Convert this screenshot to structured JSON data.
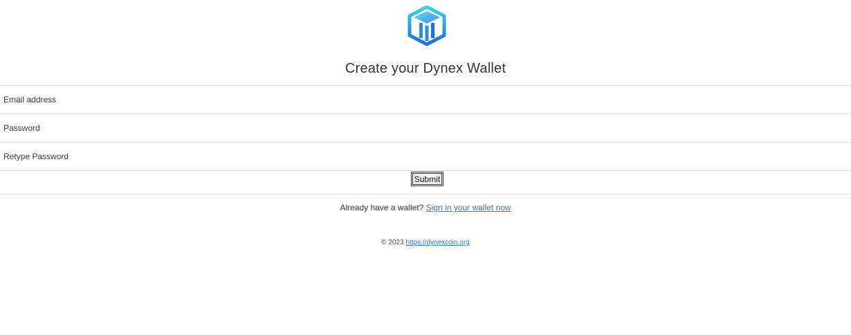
{
  "header": {
    "logo_icon": "dynex-hexagon-logo-icon",
    "title": "Create your Dynex Wallet"
  },
  "form": {
    "email_placeholder": "Email address",
    "password_placeholder": "Password",
    "retype_password_placeholder": "Retype Password",
    "submit_label": "Submit"
  },
  "signin": {
    "prompt": "Already have a wallet?",
    "link_label": "Sign in your wallet now"
  },
  "footer": {
    "copyright": "© 2023",
    "link_label": "https://dynexcoin.org"
  },
  "colors": {
    "logo_light": "#35c7e6",
    "logo_dark": "#1f6fd6",
    "link": "#3b72b8",
    "divider": "#dcdcdc"
  }
}
